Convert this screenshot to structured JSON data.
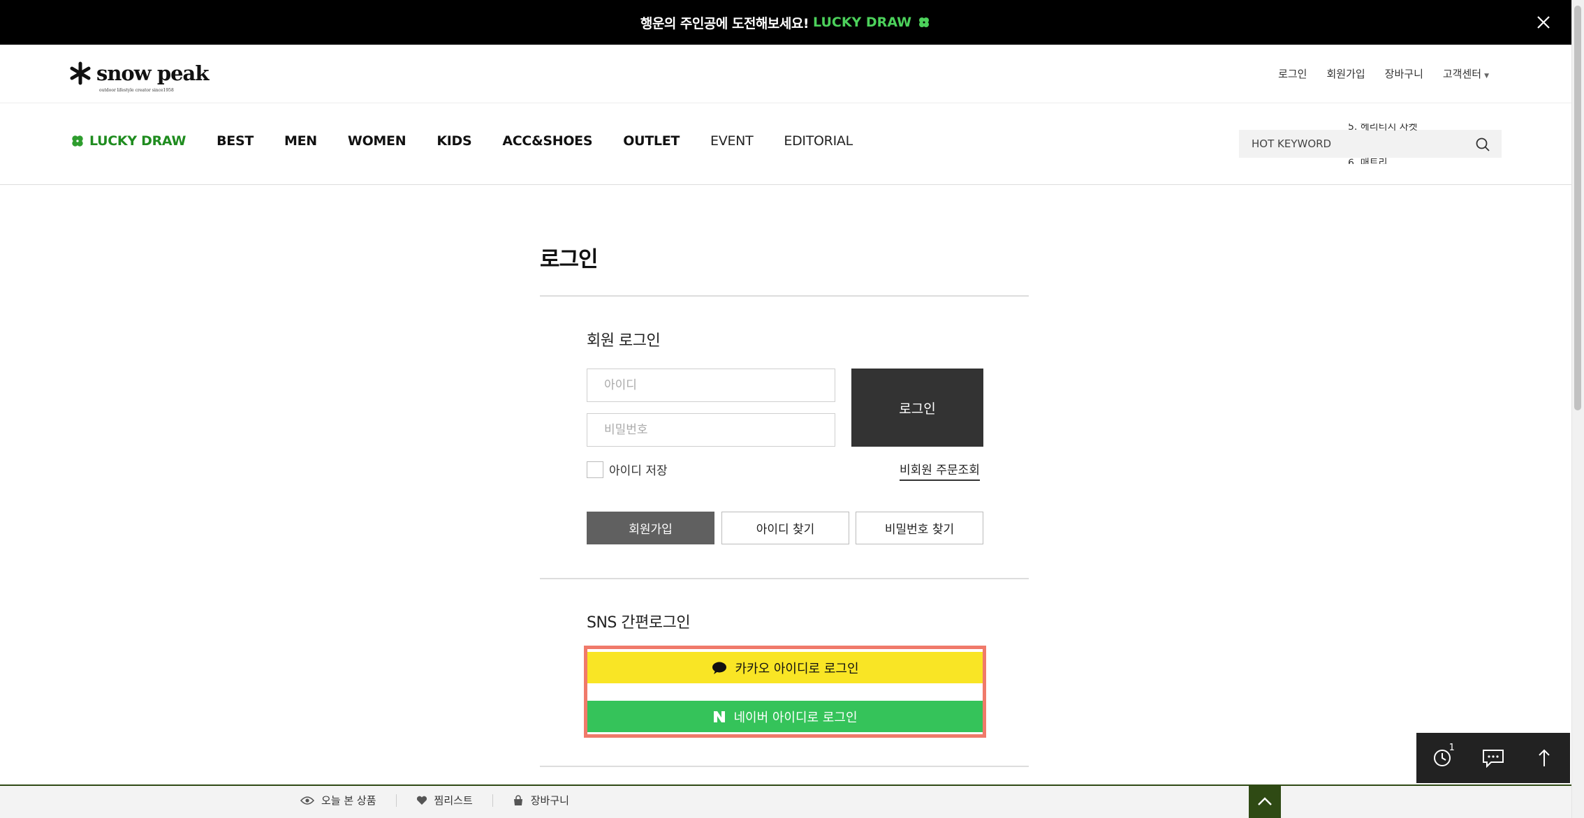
{
  "promo": {
    "text": "행운의 주인공에 도전해보세요!",
    "link": "LUCKY DRAW"
  },
  "header": {
    "logo": "snow peak",
    "logo_sub": "outdoor lifestyle creator since1958",
    "util_links": [
      "로그인",
      "회원가입",
      "장바구니",
      "고객센터"
    ]
  },
  "nav": {
    "items": [
      "LUCKY DRAW",
      "BEST",
      "MEN",
      "WOMEN",
      "KIDS",
      "ACC&SHOES",
      "OUTLET",
      "EVENT",
      "EDITORIAL"
    ],
    "search_label": "HOT KEYWORD",
    "rolling_keywords": [
      "5. 헤리티지 자켓",
      "6. 매트리"
    ]
  },
  "page": {
    "title": "로그인"
  },
  "member_login": {
    "title": "회원 로그인",
    "id_placeholder": "아이디",
    "pw_placeholder": "비밀번호",
    "login_button": "로그인",
    "remember_label": "아이디 저장",
    "guest_order": "비회원 주문조회",
    "join_button": "회원가입",
    "find_id_button": "아이디 찾기",
    "find_pw_button": "비밀번호 찾기"
  },
  "sns_login": {
    "title": "SNS 간편로그인",
    "kakao": "카카오 아이디로 로그인",
    "naver": "네이버 아이디로 로그인",
    "kakao_color": "#F9E525",
    "naver_color": "#35C35A",
    "highlight_color": "#F07A6A"
  },
  "quick_panel": {
    "recent_count": "1"
  },
  "bottom_bar": {
    "recent_products": "오늘 본 상품",
    "wishlist": "찜리스트",
    "cart": "장바구니"
  },
  "colors": {
    "accent_green": "#1F8C1F",
    "dark": "#333333",
    "bottom_bar_border": "#2F4A14"
  }
}
